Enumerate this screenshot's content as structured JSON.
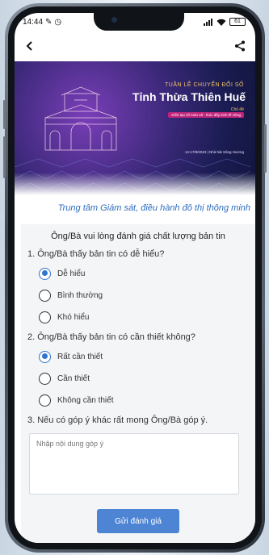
{
  "status_bar": {
    "time": "14:44",
    "battery": "61"
  },
  "app_bar": {
    "back_icon": "arrow-back-icon",
    "share_icon": "share-icon"
  },
  "banner": {
    "kicker": "TUẦN LỄ CHUYỂN ĐỔI SỐ",
    "title": "Tỉnh Thừa Thiên Huế",
    "subtitle": "Chủ đề",
    "tagline": "Kiến tạo số toàn xã - thúc đẩy kinh tế vững",
    "date_line": "14-17/8/2023 | Nhà hát Sông Hương"
  },
  "center_name": "Trung tâm Giám sát, điều hành đô thị thông minh",
  "survey": {
    "title": "Ông/Bà vui lòng đánh giá chất lượng bản tin",
    "questions": [
      {
        "label": "1. Ông/Bà thấy bản tin có dễ hiểu?",
        "options": [
          "Dễ hiểu",
          "Bình thường",
          "Khó hiểu"
        ],
        "selected": "Dễ hiểu"
      },
      {
        "label": "2. Ông/Bà thấy bản tin có cần thiết không?",
        "options": [
          "Rất cần thiết",
          "Cần thiết",
          "Không cần thiết"
        ],
        "selected": "Rất cần thiết"
      }
    ],
    "feedback_label": "3. Nếu có góp ý khác rất mong Ông/Bà góp ý.",
    "feedback_placeholder": "Nhập nội dung góp ý",
    "submit_label": "Gửi đánh giá"
  },
  "colors": {
    "accent": "#2f74d0",
    "button": "#4d84d4",
    "center_text": "#2b6dbf"
  }
}
